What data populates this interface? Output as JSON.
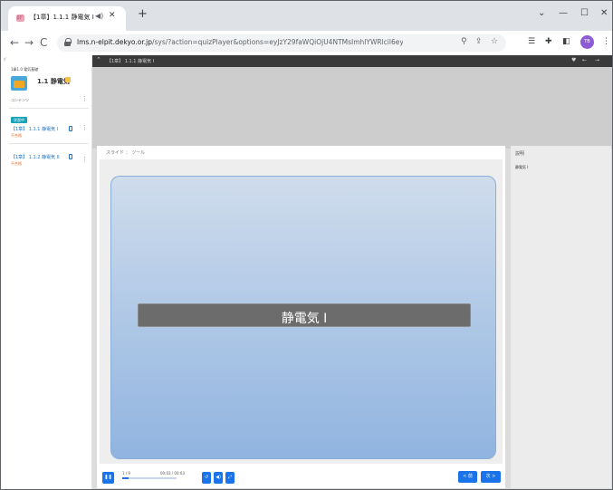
{
  "browser": {
    "tab_title": "【1章】1.1.1 静電気 I",
    "tab_favicon": "ﾛｸﾞ",
    "url_host": "lms.n-elpit.dekyo.or.jp",
    "url_path": "/sys/?action=quizPlayer&options=eyJzY29faWQiOjU4NTMsImhlYWRlcil6eyJnb29kIjp7InZpc2libGUiOn...",
    "profile_initials": "TB"
  },
  "sidebar": {
    "back_label": "ﾎﾟ",
    "chapter": "1章1.0 電気基礎",
    "course_title": "1.1 静電気",
    "contents_label": "コンテンツ",
    "study_tag": "学習中",
    "lessons": [
      {
        "title": "【1章】 1.1.1 静電気 I",
        "status": "不合格"
      },
      {
        "title": "【1章】 1.1.2 静電気 II",
        "status": "不合格"
      }
    ]
  },
  "header": {
    "title": "【1章】 1.1.1 静電気 I"
  },
  "slide_panel": {
    "tabs_label": "スライド ： ツール",
    "slide_title": "静電気 I"
  },
  "player": {
    "slide_counter": "1 / 9",
    "time": "00:03 / 00:03",
    "prev_label": "< 前",
    "next_label": "次 >",
    "progress": 0.11
  },
  "notes": {
    "label": "説明",
    "text": "静電気 I"
  }
}
